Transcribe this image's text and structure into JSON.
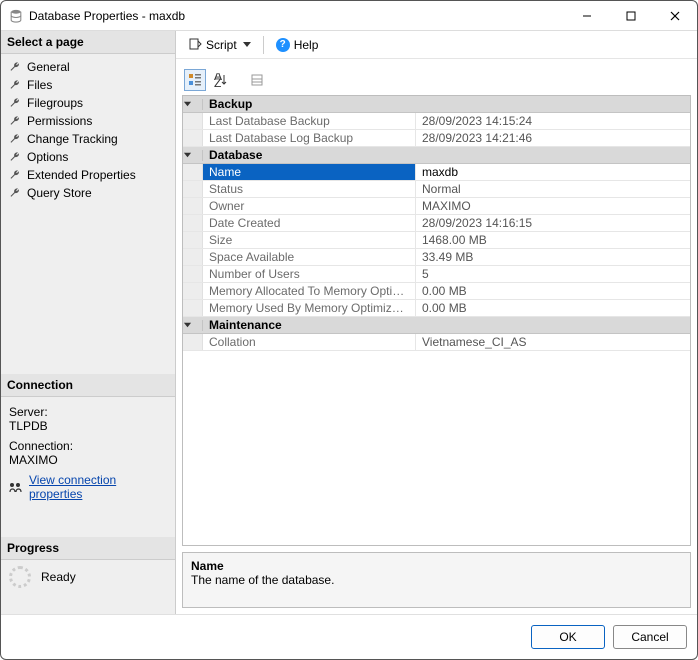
{
  "window": {
    "title": "Database Properties - maxdb"
  },
  "left": {
    "select_page": "Select a page",
    "pages": [
      "General",
      "Files",
      "Filegroups",
      "Permissions",
      "Change Tracking",
      "Options",
      "Extended Properties",
      "Query Store"
    ],
    "connection_header": "Connection",
    "server_label": "Server:",
    "server_value": "TLPDB",
    "connection_label": "Connection:",
    "connection_value": "MAXIMO",
    "view_conn_link": "View connection properties",
    "progress_header": "Progress",
    "progress_status": "Ready"
  },
  "toolbar": {
    "script_label": "Script",
    "help_label": "Help"
  },
  "grid": {
    "sections": [
      {
        "title": "Backup",
        "rows": [
          {
            "key": "Last Database Backup",
            "val": "28/09/2023 14:15:24"
          },
          {
            "key": "Last Database Log Backup",
            "val": "28/09/2023 14:21:46"
          }
        ]
      },
      {
        "title": "Database",
        "rows": [
          {
            "key": "Name",
            "val": "maxdb",
            "selected": true
          },
          {
            "key": "Status",
            "val": "Normal"
          },
          {
            "key": "Owner",
            "val": "MAXIMO"
          },
          {
            "key": "Date Created",
            "val": "28/09/2023 14:16:15"
          },
          {
            "key": "Size",
            "val": "1468.00 MB"
          },
          {
            "key": "Space Available",
            "val": "33.49 MB"
          },
          {
            "key": "Number of Users",
            "val": "5"
          },
          {
            "key": "Memory Allocated To Memory Optimized Objects",
            "val": "0.00 MB"
          },
          {
            "key": "Memory Used By Memory Optimized Objects",
            "val": "0.00 MB"
          }
        ]
      },
      {
        "title": "Maintenance",
        "rows": [
          {
            "key": "Collation",
            "val": "Vietnamese_CI_AS"
          }
        ]
      }
    ]
  },
  "description": {
    "title": "Name",
    "text": "The name of the database."
  },
  "footer": {
    "ok": "OK",
    "cancel": "Cancel"
  }
}
